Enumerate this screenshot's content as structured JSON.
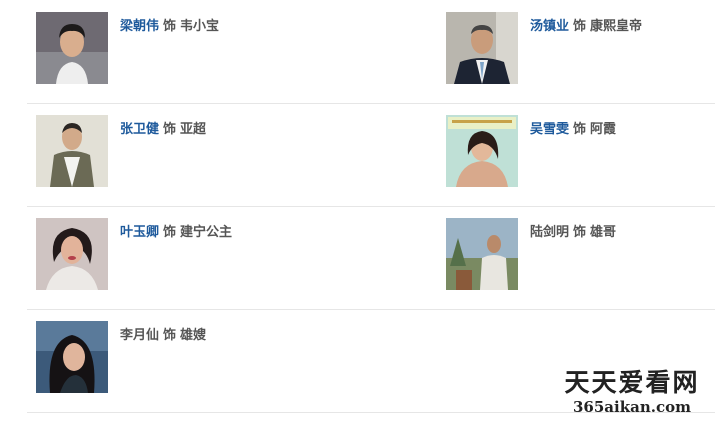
{
  "cast": [
    {
      "actor": "梁朝伟",
      "linked": true,
      "sep": "饰",
      "role": "韦小宝",
      "photo_icon": "portrait-photo-icon"
    },
    {
      "actor": "汤镇业",
      "linked": true,
      "sep": "饰",
      "role": "康熙皇帝",
      "photo_icon": "portrait-photo-icon"
    },
    {
      "actor": "张卫健",
      "linked": true,
      "sep": "饰",
      "role": "亚超",
      "photo_icon": "portrait-photo-icon"
    },
    {
      "actor": "吴雪雯",
      "linked": true,
      "sep": "饰",
      "role": "阿霞",
      "photo_icon": "portrait-photo-icon"
    },
    {
      "actor": "叶玉卿",
      "linked": true,
      "sep": "饰",
      "role": "建宁公主",
      "photo_icon": "portrait-photo-icon"
    },
    {
      "actor": "陆剑明",
      "linked": false,
      "sep": "饰",
      "role": "雄哥",
      "photo_icon": "portrait-photo-icon"
    },
    {
      "actor": "李月仙",
      "linked": false,
      "sep": "饰",
      "role": "雄嫂",
      "photo_icon": "portrait-photo-icon"
    }
  ],
  "watermark": {
    "title": "天天爱看网",
    "url": "365aikan.com"
  },
  "colors": {
    "link": "#1e5a9c",
    "text": "#555555",
    "divider": "#e6e6e6"
  }
}
